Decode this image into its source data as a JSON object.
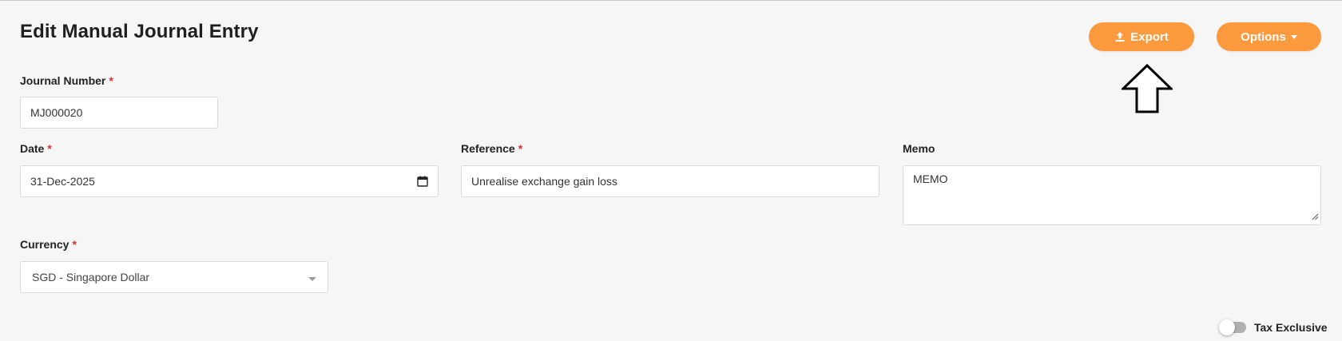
{
  "page": {
    "title": "Edit Manual Journal Entry"
  },
  "toolbar": {
    "export_label": "Export",
    "export_icon": "upload-icon",
    "options_label": "Options",
    "accent_color": "#fd9a3e"
  },
  "form": {
    "journal_number": {
      "label": "Journal Number",
      "required_mark": "*",
      "value": "MJ000020"
    },
    "date": {
      "label": "Date",
      "required_mark": "*",
      "value": "31-Dec-2025",
      "icon": "calendar-icon"
    },
    "reference": {
      "label": "Reference",
      "required_mark": "*",
      "value": "Unrealise exchange gain loss"
    },
    "memo": {
      "label": "Memo",
      "value": "MEMO"
    },
    "currency": {
      "label": "Currency",
      "required_mark": "*",
      "value": "SGD - Singapore Dollar"
    },
    "tax": {
      "label": "Tax Exclusive",
      "enabled": false
    }
  }
}
